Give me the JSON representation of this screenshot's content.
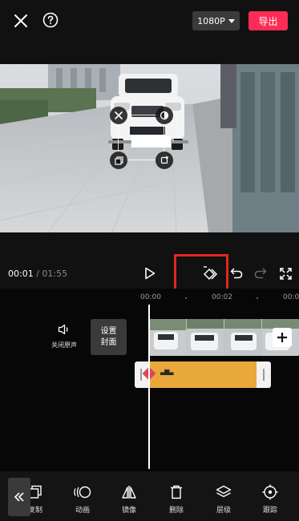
{
  "header": {
    "resolution_label": "1080P",
    "export_label": "导出"
  },
  "playback": {
    "current_time": "00:01",
    "separator": "/",
    "total_time": "01:55"
  },
  "preview": {
    "license_plate": "▆▆▆▆·"
  },
  "timeline": {
    "ticks": [
      "00:00",
      "00:02",
      "00:04"
    ],
    "mute_label": "关闭原声",
    "cover_label_line1": "设置",
    "cover_label_line2": "封面",
    "text_clip_label": "▃▆▃"
  },
  "toolbar": {
    "items": [
      {
        "label": "复制",
        "icon": "copy-icon"
      },
      {
        "label": "动画",
        "icon": "animation-icon"
      },
      {
        "label": "镜像",
        "icon": "mirror-icon"
      },
      {
        "label": "删除",
        "icon": "delete-icon"
      },
      {
        "label": "层级",
        "icon": "layers-icon"
      },
      {
        "label": "跟踪",
        "icon": "tracking-icon"
      }
    ]
  },
  "colors": {
    "accent": "#fe2c55",
    "text_clip": "#e8a93a",
    "highlight_box": "#e3261d",
    "keyframe": "#e0455e"
  }
}
